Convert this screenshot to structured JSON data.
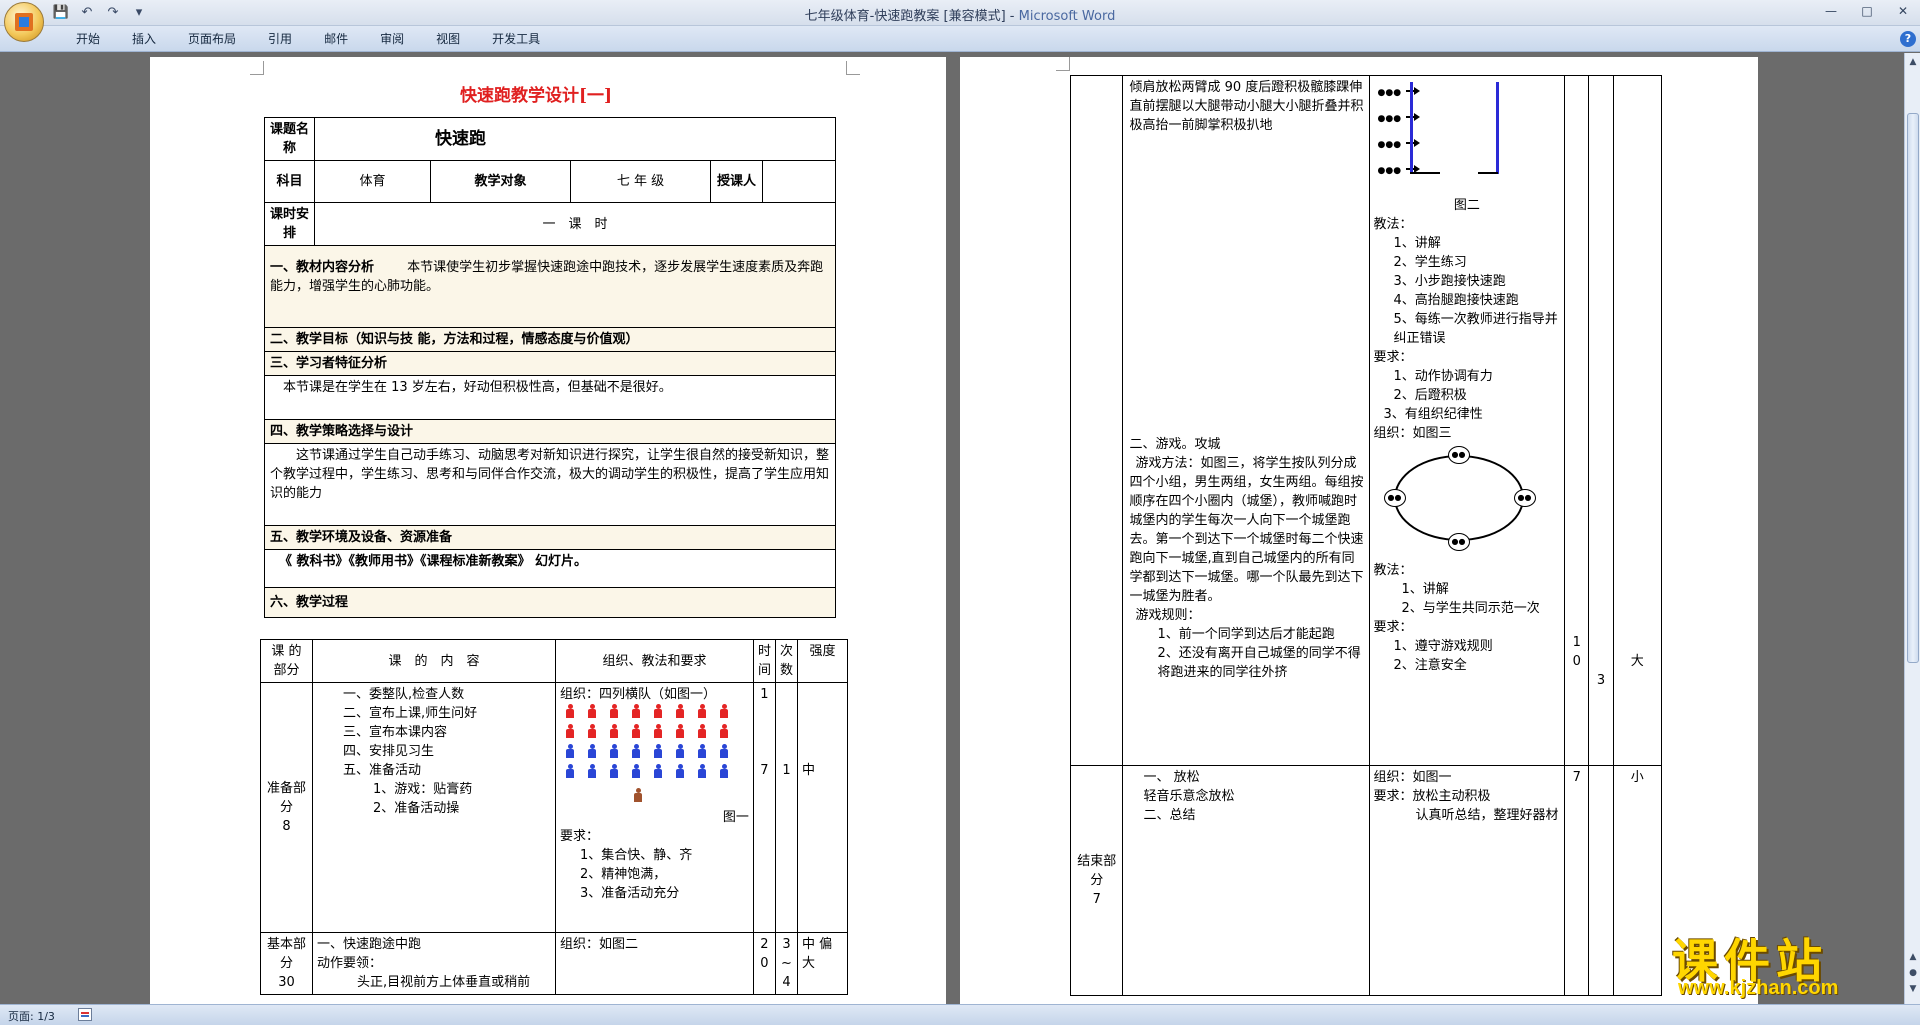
{
  "window": {
    "title_doc": "七年级体育-快速跑教案 [兼容模式] - ",
    "title_app": "Microsoft Word"
  },
  "ribbon": {
    "tabs": [
      "开始",
      "插入",
      "页面布局",
      "引用",
      "邮件",
      "审阅",
      "视图",
      "开发工具"
    ]
  },
  "status": {
    "page": "页面: 1/3"
  },
  "watermark": {
    "title": "课件站",
    "url": "www.kjzhan.com"
  },
  "page1": {
    "title": "快速跑教学设计[一]",
    "info": {
      "course_name_label": "课题名称",
      "course_name": "快速跑",
      "subject_label": "科目",
      "subject": "体育",
      "target_label": "教学对象",
      "target": "七 年 级",
      "teacher_label": "授课人",
      "hours_label": "课时安排",
      "hours": "一　课　时",
      "s1_title": "一、教材内容分析",
      "s1_text": "本节课使学生初步掌握快速跑途中跑技术，逐步发展学生速度素质及奔跑能力，增强学生的心肺功能。",
      "s2_title": "二、教学目标（知识与技 能，方法和过程，情感态度与价值观）",
      "s3_title": "三、学习者特征分析",
      "s3_text": "本节课是在学生在 13 岁左右，好动但积极性高，但基础不是很好。",
      "s4_title": "四、教学策略选择与设计",
      "s4_text": "这节课通过学生自己动手练习、动脑思考对新知识进行探究，让学生很自然的接受新知识，整个教学过程中，学生练习、思考和与同伴合作交流，极大的调动学生的积极性，提高了学生应用知识的能力",
      "s5_title": "五、教学环境及设备、资源准备",
      "s5_text": "《 教科书》《教师用书》《课程标准新教案》 幻灯片。",
      "s6_title": "六、教学过程"
    },
    "lesson": {
      "headers": [
        "课 的部分",
        "课　的　内　容",
        "组织、教法和要求",
        "时间",
        "次数",
        "强度"
      ],
      "prep": {
        "part": "准备部分",
        "minutes": "8",
        "content": [
          "一、委整队,检查人数",
          "二、宣布上课,师生问好",
          "三、宣布本课内容",
          "四、安排见习生",
          "五、准备活动"
        ],
        "games": [
          "1、游戏：贴膏药",
          "2、准备活动操"
        ],
        "org_title": "组织：四列横队（如图一）",
        "fig_label": "图一",
        "req_title": "要求：",
        "reqs": [
          "1、集合快、静、齐",
          "2、精神饱满，",
          "3、准备活动充分"
        ],
        "time1": "1",
        "time2": "7",
        "count": "1",
        "intensity": "中"
      },
      "basic": {
        "part": "基本部分",
        "minutes": "30",
        "content": [
          "一、快速跑途中跑",
          "动作要领：",
          "头正,目视前方上体垂直或稍前"
        ],
        "org": "组织：如图二",
        "time": "20",
        "count": "3~4",
        "intensity": "中 偏大"
      }
    }
  },
  "page2": {
    "basic_cont": {
      "content_top": "倾肩放松两臂成 90 度后蹬积极髋膝踝伸直前摆腿以大腿带动小腿大小腿折叠并积极高抬一前脚掌积极扒地",
      "fig2_label": "图二",
      "method_title": "教法：",
      "methods": [
        "1、讲解",
        "2、学生练习",
        "3、小步跑接快速跑",
        "4、高抬腿跑接快速跑",
        "5、每练一次教师进行指导并纠正错误"
      ],
      "req_title": "要求：",
      "reqs": [
        "1、动作协调有力",
        "2、后蹬积极",
        "3、有组织纪律性"
      ],
      "org3": "组织：如图三",
      "game_title": "二、游戏。攻城",
      "game_method": "游戏方法：如图三，将学生按队列分成四个小组，男生两组，女生两组。每组按顺序在四个小圈内（城堡），教师喊跑时城堡内的学生每次一人向下一个城堡跑去。第一个到达下一个城堡时每二个快速跑向下一城堡,直到自己城堡内的所有同学都到达下一城堡。哪一个队最先到达下一城堡为胜者。",
      "rule_title": "游戏规则：",
      "rules": [
        "1、前一个同学到达后才能起跑",
        "2、还没有离开自己城堡的同学不得将跑进来的同学往外挤"
      ],
      "method2_title": "教法：",
      "methods2": [
        "1、讲解",
        "2、与学生共同示范一次"
      ],
      "req2_title": "要求：",
      "reqs2": [
        "1、遵守游戏规则",
        "2、注意安全"
      ],
      "time": "10",
      "count": "3",
      "intensity": "大"
    },
    "end": {
      "part": "结束部分",
      "minutes": "7",
      "content": [
        "一、 放松",
        "轻音乐意念放松",
        "二、总结"
      ],
      "org": "组织：如图一",
      "req_title": "要求：放松主动积极",
      "req_text": "认真听总结，整理好器材",
      "time": "7",
      "intensity": "小"
    }
  }
}
